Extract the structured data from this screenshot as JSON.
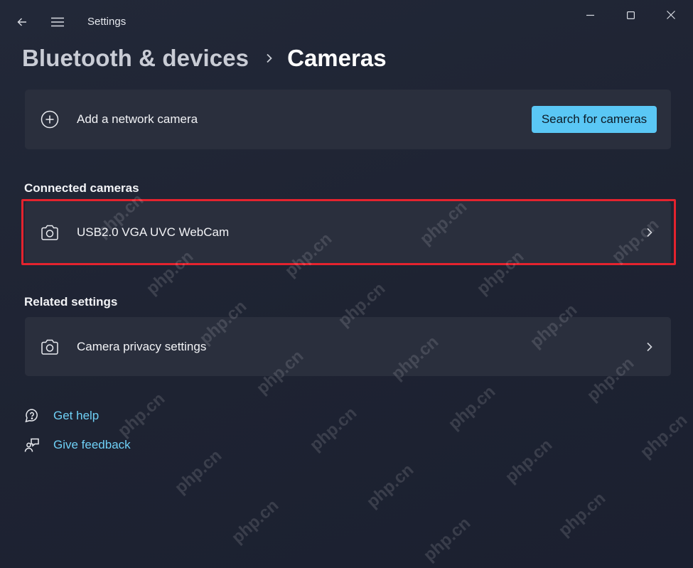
{
  "window": {
    "app_title": "Settings"
  },
  "breadcrumb": {
    "parent": "Bluetooth & devices",
    "current": "Cameras"
  },
  "add_camera": {
    "label": "Add a network camera",
    "search_button": "Search for cameras",
    "icon": "add-circle-icon"
  },
  "connected_cameras": {
    "title": "Connected cameras",
    "items": [
      {
        "label": "USB2.0 VGA UVC WebCam",
        "icon": "camera-icon"
      }
    ]
  },
  "related_settings": {
    "title": "Related settings",
    "items": [
      {
        "label": "Camera privacy settings",
        "icon": "camera-icon"
      }
    ]
  },
  "help": {
    "get_help": "Get help",
    "give_feedback": "Give feedback"
  },
  "watermark": {
    "text": "php.cn"
  },
  "colors": {
    "background": "#202534",
    "card": "#2a2f3d",
    "accent": "#5ac7f5",
    "link": "#6fd0f6",
    "highlight": "#e4232e"
  }
}
